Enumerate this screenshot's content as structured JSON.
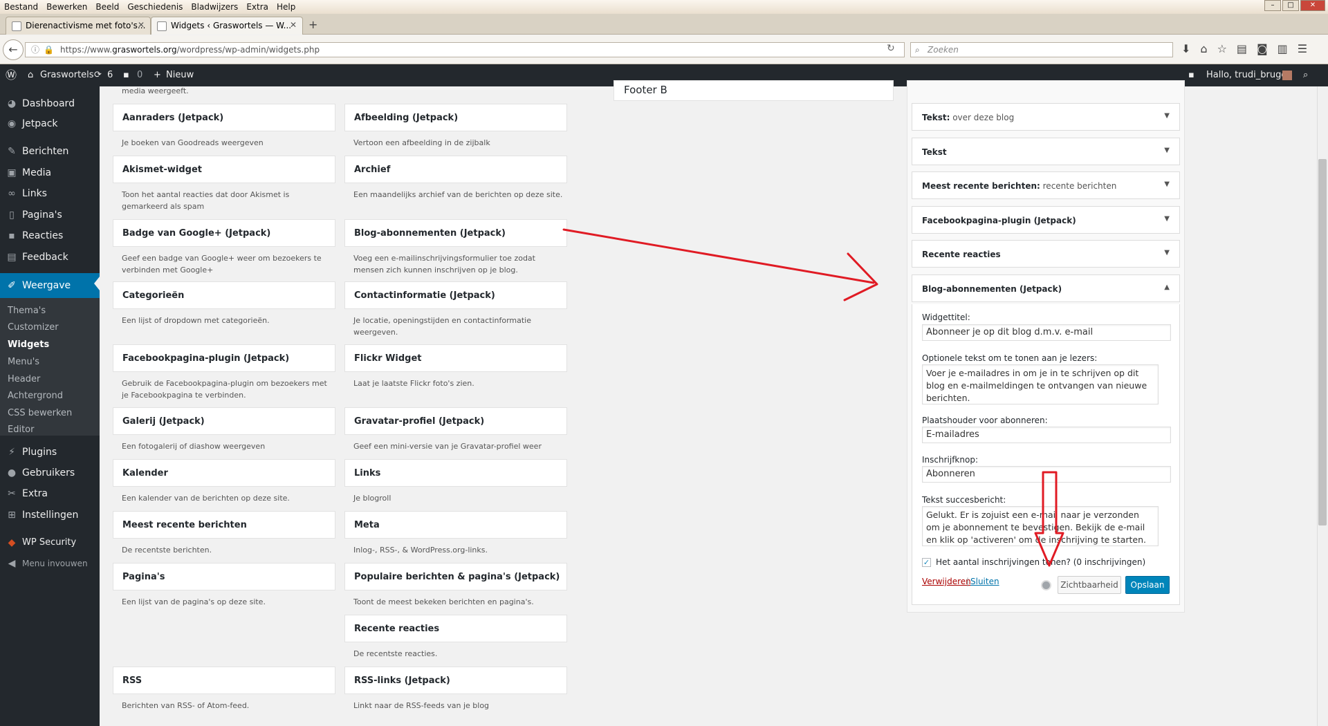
{
  "browser": {
    "menubar": [
      "Bestand",
      "Bewerken",
      "Beeld",
      "Geschiedenis",
      "Bladwijzers",
      "Extra",
      "Help"
    ],
    "tabs": [
      {
        "title": "Dierenactivisme met foto's..."
      },
      {
        "title": "Widgets ‹ Graswortels — W..."
      }
    ],
    "url_prefix": "https://www.",
    "url_domain": "graswortels.org",
    "url_path": "/wordpress/wp-admin/widgets.php",
    "search_placeholder": "Zoeken"
  },
  "adminbar": {
    "site": "Graswortels",
    "updates": "6",
    "comments": "0",
    "new": "Nieuw",
    "greeting": "Hallo, trudi_bruges"
  },
  "sidebar": {
    "items": [
      {
        "label": "Dashboard",
        "icon": "dashboard-icon"
      },
      {
        "label": "Jetpack",
        "icon": "jetpack-icon"
      },
      {
        "label": "Berichten",
        "icon": "pin-icon"
      },
      {
        "label": "Media",
        "icon": "media-icon"
      },
      {
        "label": "Links",
        "icon": "link-icon"
      },
      {
        "label": "Pagina's",
        "icon": "page-icon"
      },
      {
        "label": "Reacties",
        "icon": "comment-icon"
      },
      {
        "label": "Feedback",
        "icon": "feedback-icon"
      },
      {
        "label": "Weergave",
        "icon": "brush-icon"
      },
      {
        "label": "Plugins",
        "icon": "plugin-icon"
      },
      {
        "label": "Gebruikers",
        "icon": "users-icon"
      },
      {
        "label": "Extra",
        "icon": "tools-icon"
      },
      {
        "label": "Instellingen",
        "icon": "settings-icon"
      },
      {
        "label": "WP Security",
        "icon": "security-icon"
      },
      {
        "label": "Menu invouwen",
        "icon": "collapse-icon"
      }
    ],
    "submenu": [
      "Thema's",
      "Customizer",
      "Widgets",
      "Menu's",
      "Header",
      "Achtergrond",
      "CSS bewerken",
      "Editor"
    ]
  },
  "available_widgets": {
    "top_desc": "media weergeeft.",
    "rows": [
      [
        {
          "title": "Aanraders (Jetpack)",
          "desc": "Je boeken van Goodreads weergeven"
        },
        {
          "title": "Afbeelding (Jetpack)",
          "desc": "Vertoon een afbeelding in de zijbalk"
        }
      ],
      [
        {
          "title": "Akismet-widget",
          "desc": "Toon het aantal reacties dat door Akismet is gemarkeerd als spam"
        },
        {
          "title": "Archief",
          "desc": "Een maandelijks archief van de berichten op deze site."
        }
      ],
      [
        {
          "title": "Badge van Google+ (Jetpack)",
          "desc": "Geef een badge van Google+ weer om bezoekers te verbinden met Google+"
        },
        {
          "title": "Blog-abonnementen (Jetpack)",
          "desc": "Voeg een e-mailinschrijvingsformulier toe zodat mensen zich kunnen inschrijven op je blog."
        }
      ],
      [
        {
          "title": "Categorieën",
          "desc": "Een lijst of dropdown met categorieën."
        },
        {
          "title": "Contactinformatie (Jetpack)",
          "desc": "Je locatie, openingstijden en contactinformatie weergeven."
        }
      ],
      [
        {
          "title": "Facebookpagina-plugin (Jetpack)",
          "desc": "Gebruik de Facebookpagina-plugin om bezoekers met je Facebookpagina te verbinden."
        },
        {
          "title": "Flickr Widget",
          "desc": "Laat je laatste Flickr foto's zien."
        }
      ],
      [
        {
          "title": "Galerij (Jetpack)",
          "desc": "Een fotogalerij of diashow weergeven"
        },
        {
          "title": "Gravatar-profiel (Jetpack)",
          "desc": "Geef een mini-versie van je Gravatar-profiel weer"
        }
      ],
      [
        {
          "title": "Kalender",
          "desc": "Een kalender van de berichten op deze site."
        },
        {
          "title": "Links",
          "desc": "Je blogroll"
        }
      ],
      [
        {
          "title": "Meest recente berichten",
          "desc": "De recentste berichten."
        },
        {
          "title": "Meta",
          "desc": "Inlog-, RSS-, & WordPress.org-links."
        }
      ],
      [
        {
          "title": "Pagina's",
          "desc": "Een lijst van de pagina's op deze site."
        },
        {
          "title": "Populaire berichten & pagina's (Jetpack)",
          "desc": "Toont de meest bekeken berichten en pagina's."
        }
      ],
      [
        {
          "title": "",
          "desc": ""
        },
        {
          "title": "Recente reacties",
          "desc": "De recentste reacties."
        }
      ],
      [
        {
          "title": "RSS",
          "desc": "Berichten van RSS- of Atom-feed."
        },
        {
          "title": "RSS-links (Jetpack)",
          "desc": "Linkt naar de RSS-feeds van je blog"
        }
      ]
    ]
  },
  "footer_b": "Footer B",
  "sidebar_area": {
    "widgets": [
      {
        "name": "Tekst:",
        "sub": "over deze blog"
      },
      {
        "name": "Tekst",
        "sub": ""
      },
      {
        "name": "Meest recente berichten:",
        "sub": "recente berichten"
      },
      {
        "name": "Facebookpagina-plugin (Jetpack)",
        "sub": ""
      },
      {
        "name": "Recente reacties",
        "sub": ""
      },
      {
        "name": "Blog-abonnementen (Jetpack)",
        "sub": ""
      }
    ],
    "form": {
      "title_label": "Widgettitel:",
      "title_value": "Abonneer je op dit blog d.m.v. e-mail",
      "optional_label": "Optionele tekst om te tonen aan je lezers:",
      "optional_value": "Voer je e-mailadres in om je in te schrijven op dit blog en e-mailmeldingen te ontvangen van nieuwe berichten.",
      "placeholder_label": "Plaatshouder voor abonneren:",
      "placeholder_value": "E-mailadres",
      "button_label": "Inschrijfknop:",
      "button_value": "Abonneren",
      "success_label": "Tekst succesbericht:",
      "success_value": "Gelukt. Er is zojuist een e-mail naar je verzonden om je abonnement te bevestigen. Bekijk de e-mail en klik op 'activeren' om de inschrijving te starten.",
      "checkbox_label": "Het aantal inschrijvingen tonen? (0 inschrijvingen)",
      "delete": "Verwijderen",
      "separator": "|",
      "close": "Sluiten",
      "visibility": "Zichtbaarheid",
      "save": "Opslaan"
    }
  },
  "colors": {
    "annotation": "#e01b24",
    "wp_blue": "#0073aa",
    "admin_dark": "#23282d"
  }
}
